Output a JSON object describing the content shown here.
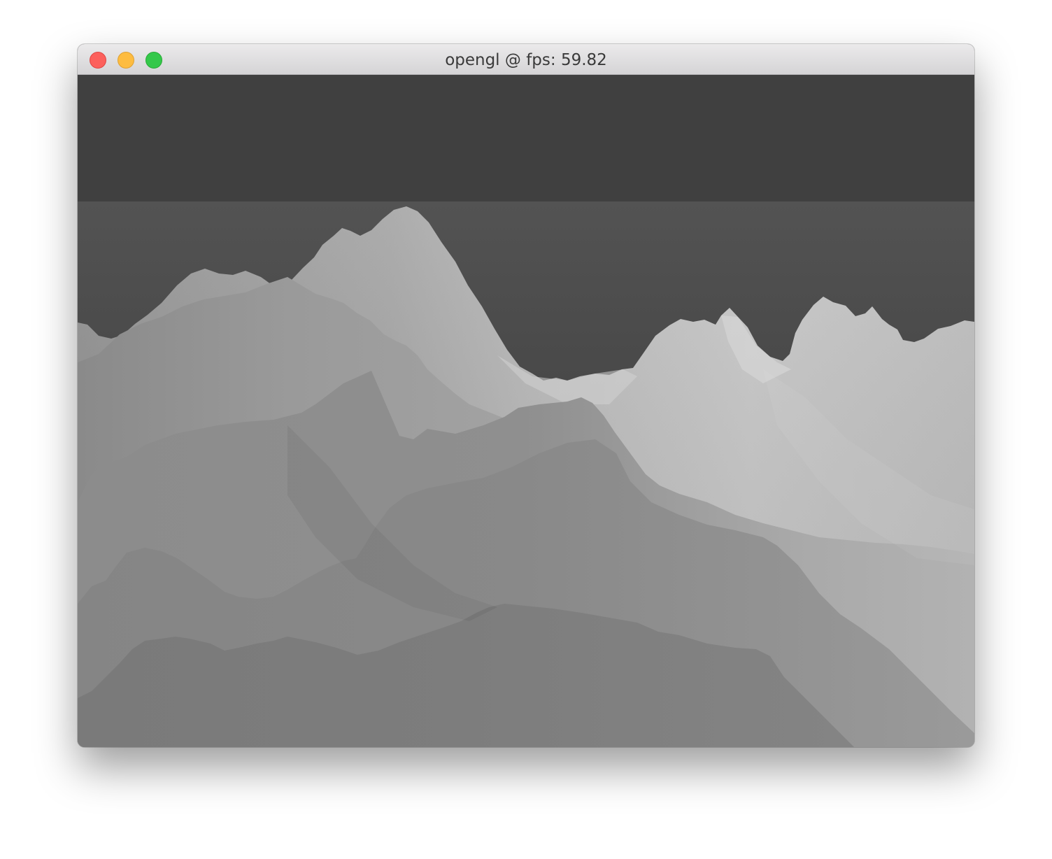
{
  "window": {
    "title": "opengl @ fps: 59.82",
    "controls": {
      "close": "close-button",
      "minimize": "minimize-button",
      "zoom": "zoom-button"
    }
  },
  "scene": {
    "description_icon": "terrain-render",
    "sky_color": "#404040"
  }
}
